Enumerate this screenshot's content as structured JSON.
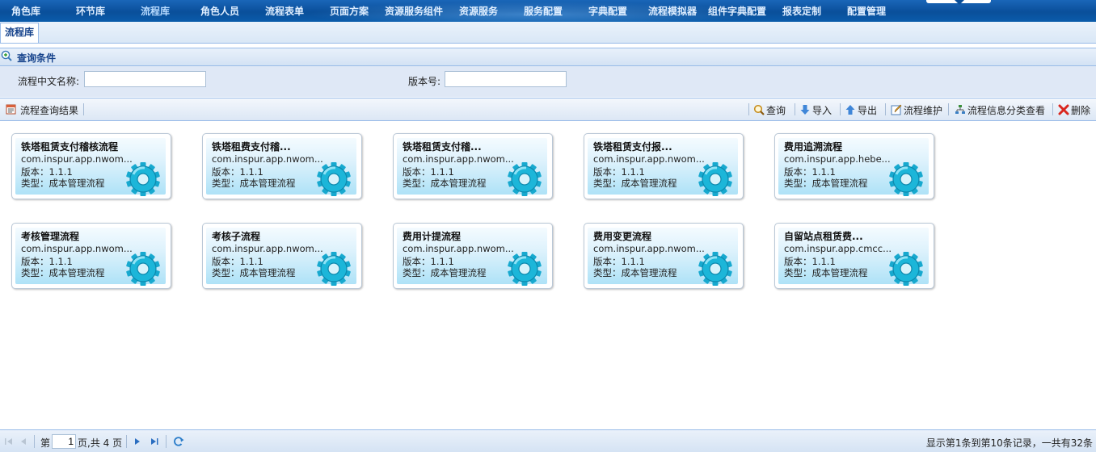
{
  "nav": {
    "items": [
      "角色库",
      "环节库",
      "流程库",
      "角色人员",
      "流程表单",
      "页面方案",
      "资源服务组件",
      "资源服务",
      "服务配置",
      "字典配置",
      "流程模拟器",
      "组件字典配置",
      "报表定制",
      "配置管理"
    ]
  },
  "tabs": [
    "流程库"
  ],
  "query": {
    "title": "查询条件",
    "name_label": "流程中文名称:",
    "name_value": "",
    "version_label": "版本号:",
    "version_value": ""
  },
  "results": {
    "title": "流程查询结果",
    "actions": [
      "查询",
      "导入",
      "导出",
      "流程维护",
      "流程信息分类查看",
      "删除"
    ]
  },
  "cards": [
    {
      "title": "铁塔租赁支付稽核流程",
      "package": "com.inspur.app.nwom...",
      "version": "版本：1.1.1",
      "type": "类型：成本管理流程"
    },
    {
      "title": "铁塔租费支付稽...",
      "package": "com.inspur.app.nwom...",
      "version": "版本：1.1.1",
      "type": "类型：成本管理流程"
    },
    {
      "title": "铁塔租赁支付稽...",
      "package": "com.inspur.app.nwom...",
      "version": "版本：1.1.1",
      "type": "类型：成本管理流程"
    },
    {
      "title": "铁塔租赁支付报...",
      "package": "com.inspur.app.nwom...",
      "version": "版本：1.1.1",
      "type": "类型：成本管理流程"
    },
    {
      "title": "费用追溯流程",
      "package": "com.inspur.app.hebe...",
      "version": "版本：1.1.1",
      "type": "类型：成本管理流程"
    },
    {
      "title": "考核管理流程",
      "package": "com.inspur.app.nwom...",
      "version": "版本：1.1.1",
      "type": "类型：成本管理流程"
    },
    {
      "title": "考核子流程",
      "package": "com.inspur.app.nwom...",
      "version": "版本：1.1.1",
      "type": "类型：成本管理流程"
    },
    {
      "title": "费用计提流程",
      "package": "com.inspur.app.nwom...",
      "version": "版本：1.1.1",
      "type": "类型：成本管理流程"
    },
    {
      "title": "费用变更流程",
      "package": "com.inspur.app.nwom...",
      "version": "版本：1.1.1",
      "type": "类型：成本管理流程"
    },
    {
      "title": "自留站点租赁费...",
      "package": "com.inspur.app.cmcc...",
      "version": "版本：1.1.1",
      "type": "类型：成本管理流程"
    }
  ],
  "pager": {
    "page_prefix": "第",
    "page_value": "1",
    "page_suffix": "页,共 4 页",
    "summary": "显示第1条到第10条记录，一共有32条"
  },
  "colors": {
    "nav_bg": "#0b5cab",
    "panel_bg": "#dfe8f6",
    "border": "#99bbe8",
    "title_blue": "#15428b"
  },
  "icons": {
    "query": "magnifier-icon",
    "import": "arrow-down-icon",
    "export": "arrow-up-icon",
    "maintain": "edit-icon",
    "classify": "tree-icon",
    "delete": "red-x-icon",
    "card": "gear-icon"
  }
}
